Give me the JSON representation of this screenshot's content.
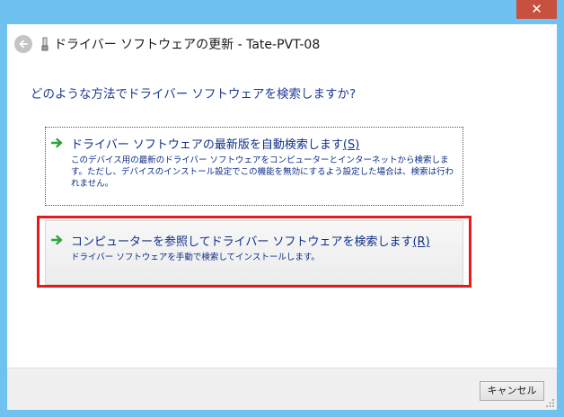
{
  "window": {
    "close_label": "✕"
  },
  "header": {
    "title": "ドライバー ソフトウェアの更新 - Tate-PVT-08",
    "back_icon": "back-arrow-icon",
    "device_icon": "device-icon"
  },
  "main": {
    "question": "どのような方法でドライバー ソフトウェアを検索しますか?",
    "options": [
      {
        "title": "ドライバー ソフトウェアの最新版を自動検索します",
        "accelerator": "(S)",
        "description": "このデバイス用の最新のドライバー ソフトウェアをコンピューターとインターネットから検索します。ただし、デバイスのインストール設定でこの機能を無効にするよう設定した場合は、検索は行われません。",
        "icon": "green-arrow-icon"
      },
      {
        "title": "コンピューターを参照してドライバー ソフトウェアを検索します",
        "accelerator": "(R)",
        "description": "ドライバー ソフトウェアを手動で検索してインストールします。",
        "icon": "green-arrow-icon"
      }
    ]
  },
  "footer": {
    "cancel_label": "キャンセル"
  },
  "colors": {
    "frame": "#6fc2ef",
    "close": "#c7503f",
    "link_text": "#0f2f8a",
    "arrow": "#2ea43a",
    "highlight": "#e81919"
  }
}
